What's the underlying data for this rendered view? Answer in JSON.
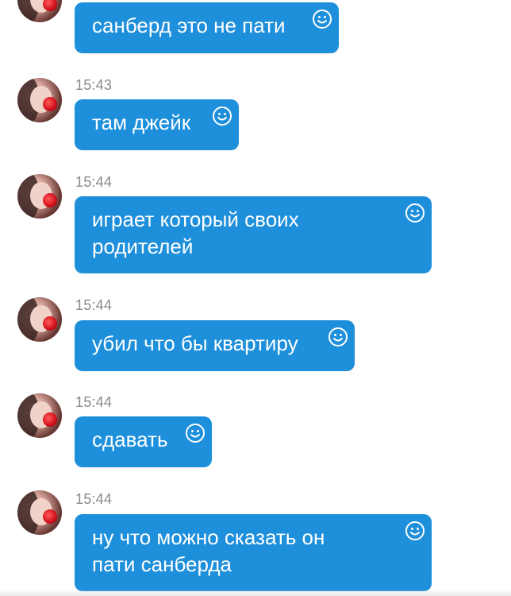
{
  "colors": {
    "bubble": "#1e8fdb",
    "bubble_text": "#ffffff",
    "timestamp": "#8a8a8a",
    "background": "#ffffff"
  },
  "messages": [
    {
      "time": "",
      "text": "санберд это не пати",
      "icon": "smiley-icon"
    },
    {
      "time": "15:43",
      "text": "там джейк",
      "icon": "smiley-icon"
    },
    {
      "time": "15:44",
      "text": "играет который своих родителей",
      "icon": "smiley-icon"
    },
    {
      "time": "15:44",
      "text": "убил что бы квартиру",
      "icon": "smiley-icon"
    },
    {
      "time": "15:44",
      "text": "сдавать",
      "icon": "smiley-icon"
    },
    {
      "time": "15:44",
      "text": "ну что можно сказать он пати санберда",
      "icon": "smiley-icon"
    }
  ]
}
